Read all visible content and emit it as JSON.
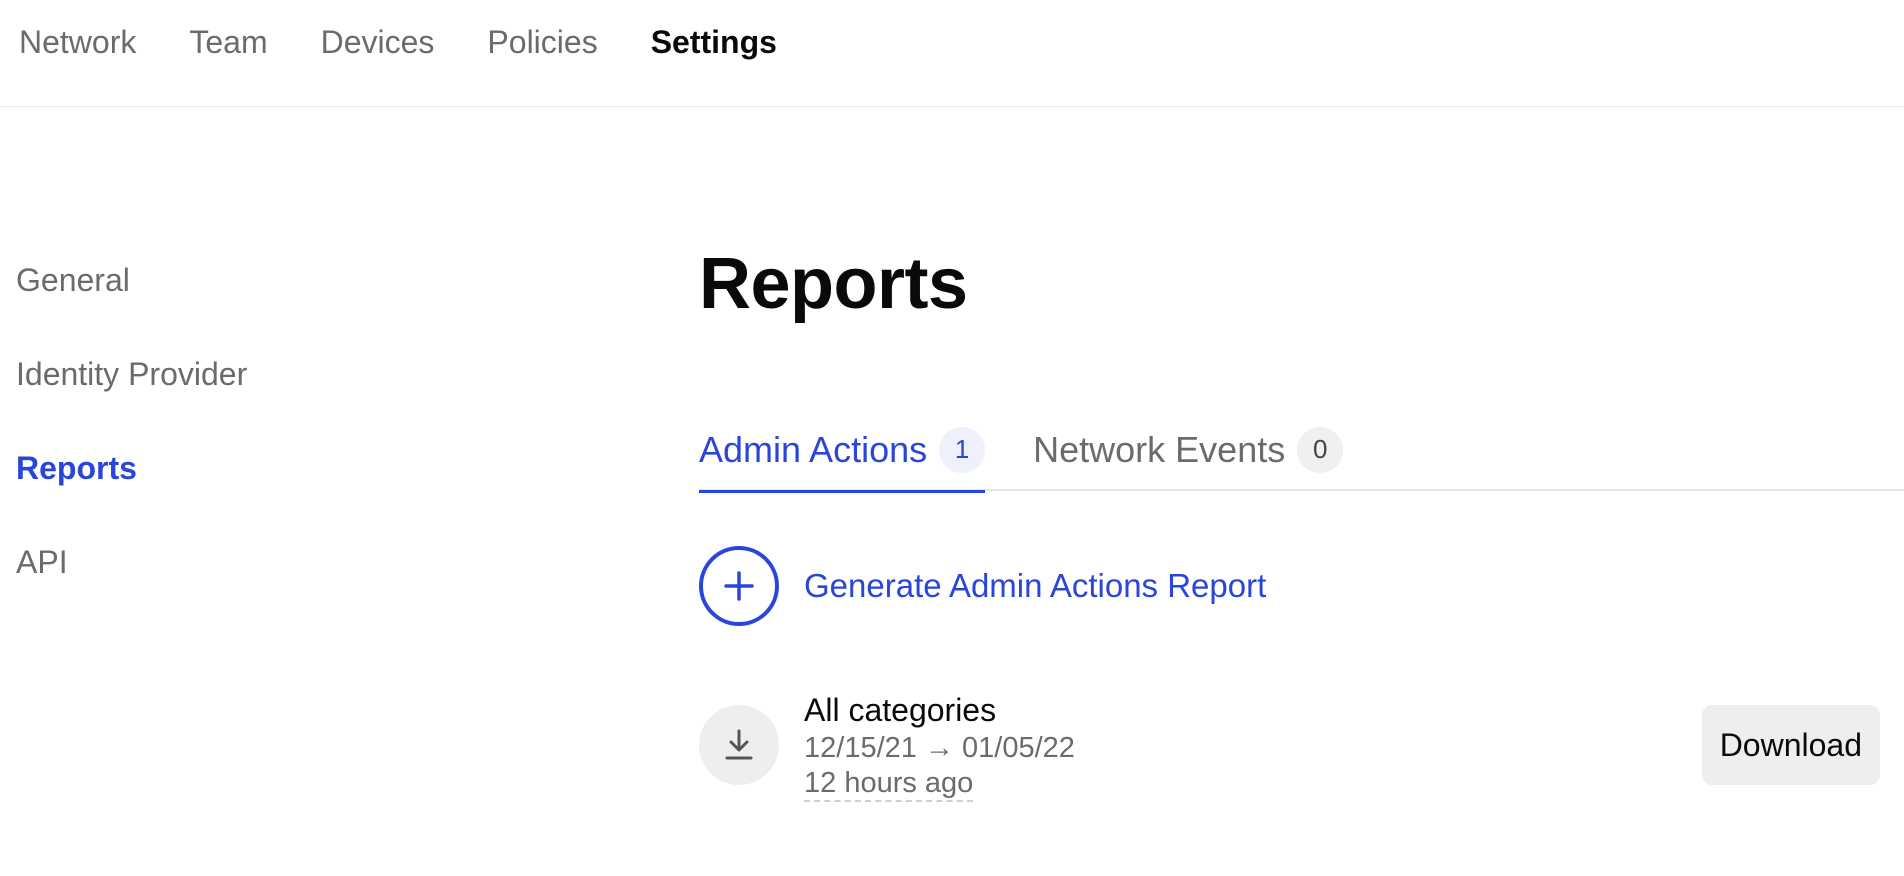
{
  "topnav": {
    "items": [
      {
        "label": "Network",
        "active": false
      },
      {
        "label": "Team",
        "active": false
      },
      {
        "label": "Devices",
        "active": false
      },
      {
        "label": "Policies",
        "active": false
      },
      {
        "label": "Settings",
        "active": true
      }
    ]
  },
  "sidebar": {
    "items": [
      {
        "label": "General"
      },
      {
        "label": "Identity Provider"
      },
      {
        "label": "Reports"
      },
      {
        "label": "API"
      }
    ]
  },
  "main": {
    "title": "Reports",
    "tabs": [
      {
        "label": "Admin Actions",
        "count": "1"
      },
      {
        "label": "Network Events",
        "count": "0"
      }
    ],
    "generate_label": "Generate Admin Actions Report",
    "reports": [
      {
        "name": "All categories",
        "range": "12/15/21 → 01/05/22",
        "time": "12 hours ago",
        "download_label": "Download"
      }
    ]
  },
  "colors": {
    "accent": "#2a45d9",
    "muted_text": "#6b6b6b",
    "chip_bg": "#eeeeef"
  },
  "icons": {
    "generate": "plus-icon",
    "report": "download-icon"
  }
}
